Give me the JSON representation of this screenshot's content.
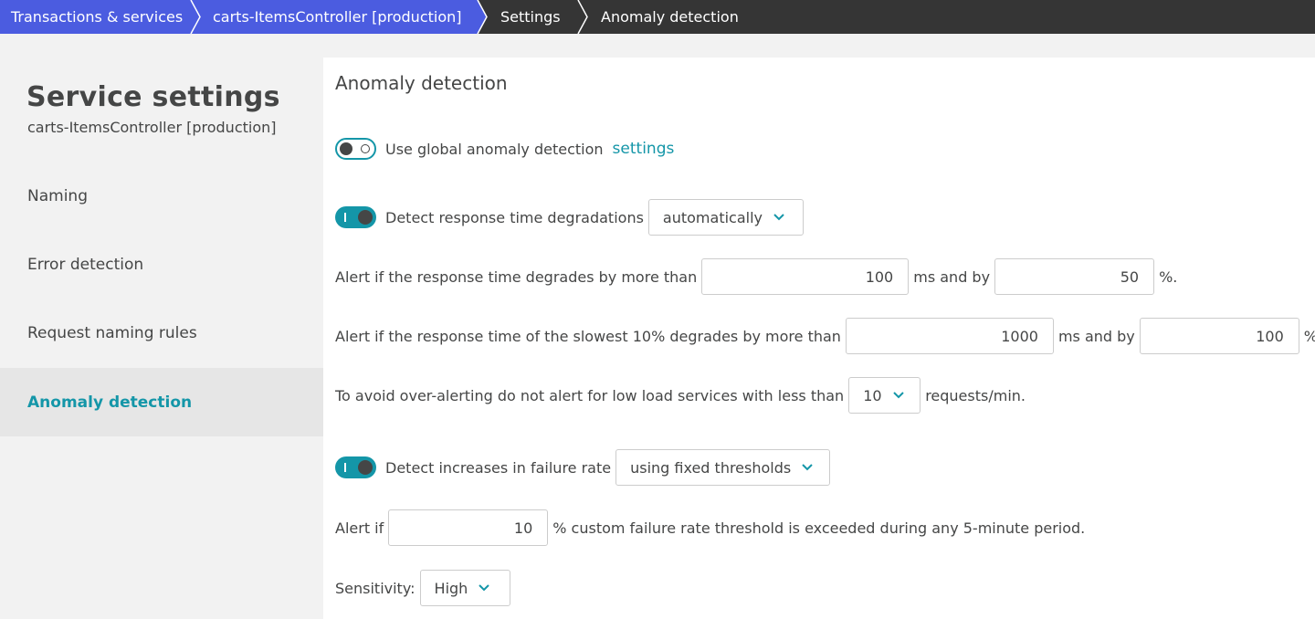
{
  "breadcrumb": [
    {
      "label": "Transactions & services"
    },
    {
      "label": "carts-ItemsController [production]"
    },
    {
      "label": "Settings"
    },
    {
      "label": "Anomaly detection"
    }
  ],
  "sidebar": {
    "title": "Service settings",
    "subtitle": "carts-ItemsController [production]",
    "items": [
      {
        "label": "Naming"
      },
      {
        "label": "Error detection"
      },
      {
        "label": "Request naming rules"
      },
      {
        "label": "Anomaly detection"
      }
    ]
  },
  "main": {
    "title": "Anomaly detection",
    "global": {
      "label": "Use global anomaly detection",
      "link": "settings",
      "enabled": false
    },
    "response_time": {
      "label": "Detect response time degradations",
      "mode": "automatically",
      "enabled": true,
      "alert1_prefix": "Alert if the response time degrades by more than",
      "alert1_ms": "100",
      "alert1_mid": "ms and by",
      "alert1_pct": "50",
      "alert1_suffix": "%.",
      "alert2_prefix": "Alert if the response time of the slowest 10% degrades by more than",
      "alert2_ms": "1000",
      "alert2_mid": "ms and by",
      "alert2_pct": "100",
      "alert2_suffix": "%.",
      "load_prefix": "To avoid over-alerting do not alert for low load services with less than",
      "load_value": "10",
      "load_suffix": "requests/min."
    },
    "failure_rate": {
      "label": "Detect increases in failure rate",
      "mode": "using fixed thresholds",
      "enabled": true,
      "alert_prefix": "Alert if",
      "alert_value": "10",
      "alert_suffix": "% custom failure rate threshold is exceeded during any 5-minute period.",
      "sensitivity_label": "Sensitivity:",
      "sensitivity_value": "High"
    }
  },
  "colors": {
    "accent": "#1496a8",
    "breadcrumb_blue": "#4b5ce0",
    "breadcrumb_dark": "#353535"
  }
}
